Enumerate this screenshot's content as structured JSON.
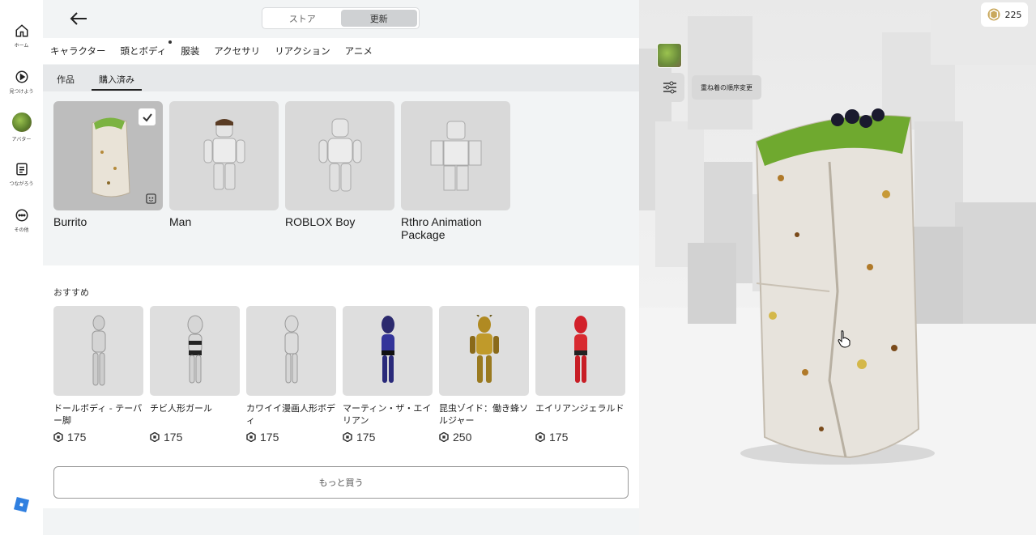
{
  "nav": {
    "items": [
      {
        "label": "ホーム",
        "icon": "home-icon"
      },
      {
        "label": "見つけよう",
        "icon": "play-icon"
      },
      {
        "label": "アバター",
        "icon": "avatar-icon"
      },
      {
        "label": "つながろう",
        "icon": "chat-icon"
      },
      {
        "label": "その他",
        "icon": "more-icon"
      }
    ]
  },
  "header": {
    "segment": [
      "ストア",
      "更新"
    ],
    "active_segment": "更新"
  },
  "category_tabs": [
    "キャラクター",
    "頭とボディ",
    "服装",
    "アクセサリ",
    "リアクション",
    "アニメ"
  ],
  "sub_tabs": [
    "作品",
    "購入済み"
  ],
  "owned": [
    {
      "name": "Burrito",
      "selected": true
    },
    {
      "name": "Man"
    },
    {
      "name": "ROBLOX Boy"
    },
    {
      "name": "Rthro Animation Package"
    }
  ],
  "recommended": {
    "title": "おすすめ",
    "items": [
      {
        "name": "ドールボディ ‐ テーパー脚",
        "price": "175"
      },
      {
        "name": "チビ人形ガール",
        "price": "175"
      },
      {
        "name": "カワイイ漫画人形ボディ",
        "price": "175"
      },
      {
        "name": "マーティン・ザ・エイリアン",
        "price": "175"
      },
      {
        "name": "昆虫ゾイド：働き蜂ソルジャー",
        "price": "250"
      },
      {
        "name": "エイリアンジェラルド",
        "price": "175"
      }
    ],
    "more_button": "もっと買う"
  },
  "scene": {
    "robux": "225",
    "tooltip": "重ね着の順序変更"
  },
  "colors": {
    "accent": "#335fff",
    "panel_bg": "#f2f4f5",
    "tab_bg": "#ffffff"
  }
}
